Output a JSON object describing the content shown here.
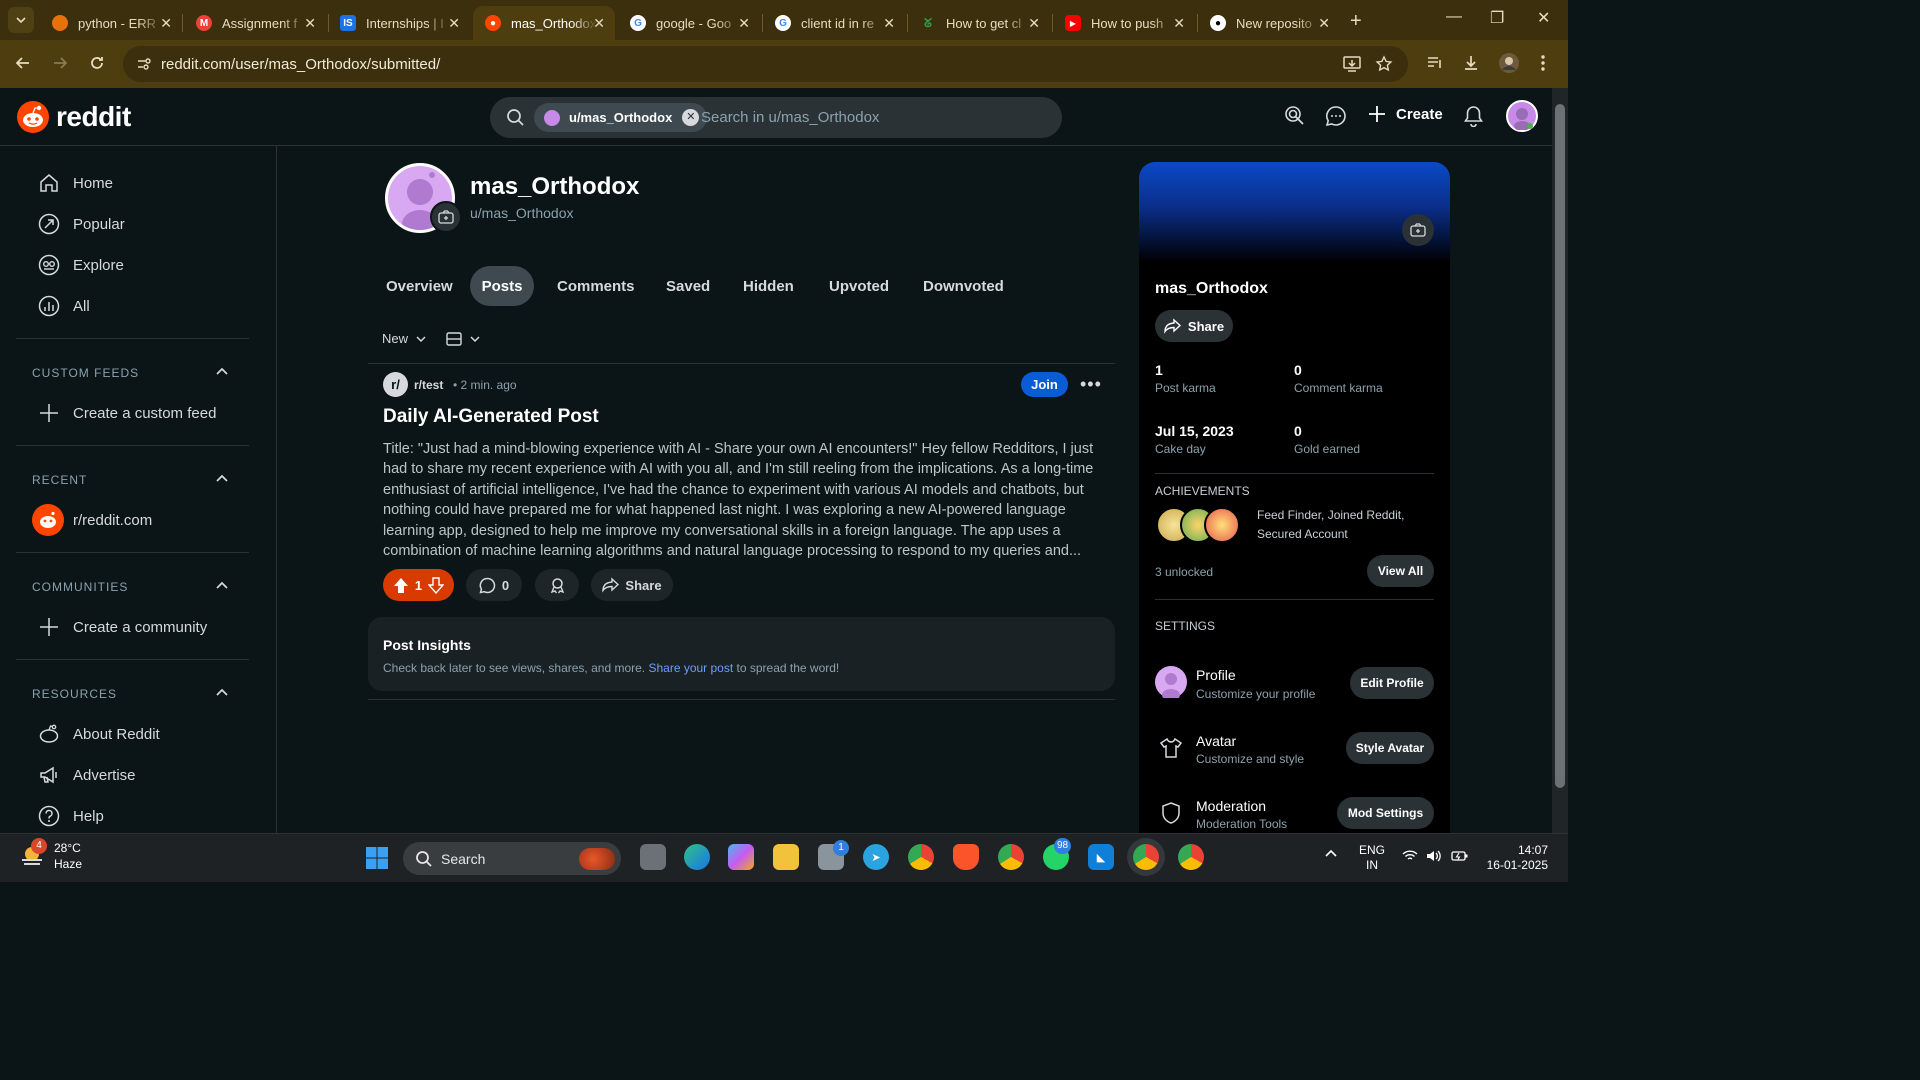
{
  "browser": {
    "tabs": [
      {
        "label": "python - ERR",
        "favicon_color": "#e8710a"
      },
      {
        "label": "Assignment f",
        "favicon_color": "#ea4335"
      },
      {
        "label": "Internships | I",
        "favicon_color": "#1a73e8"
      },
      {
        "label": "mas_Orthodox",
        "favicon_color": "#ff4500",
        "active": true
      },
      {
        "label": "google - Goo",
        "favicon_color": "#4285f4"
      },
      {
        "label": "client id in re",
        "favicon_color": "#4285f4"
      },
      {
        "label": "How to get cl",
        "favicon_color": "#2e7d32"
      },
      {
        "label": "How to push",
        "favicon_color": "#ff0000"
      },
      {
        "label": "New reposito",
        "favicon_color": "#ffffff"
      }
    ],
    "url": "reddit.com/user/mas_Orthodox/submitted/"
  },
  "header": {
    "logo_text": "reddit",
    "search_chip": "u/mas_Orthodox",
    "search_placeholder": "Search in u/mas_Orthodox",
    "create_label": "Create"
  },
  "sidebar": {
    "main_items": [
      {
        "label": "Home",
        "icon": "home-icon"
      },
      {
        "label": "Popular",
        "icon": "popular-icon"
      },
      {
        "label": "Explore",
        "icon": "explore-icon"
      },
      {
        "label": "All",
        "icon": "all-icon"
      }
    ],
    "custom_feeds": {
      "title": "CUSTOM FEEDS",
      "items": [
        {
          "label": "Create a custom feed"
        }
      ]
    },
    "recent": {
      "title": "RECENT",
      "items": [
        {
          "label": "r/reddit.com"
        }
      ]
    },
    "communities": {
      "title": "COMMUNITIES",
      "items": [
        {
          "label": "Create a community"
        }
      ]
    },
    "resources": {
      "title": "RESOURCES",
      "items": [
        {
          "label": "About Reddit",
          "icon": "reddit-alien-icon"
        },
        {
          "label": "Advertise",
          "icon": "megaphone-icon"
        },
        {
          "label": "Help",
          "icon": "help-icon"
        }
      ]
    }
  },
  "profile": {
    "display_name": "mas_Orthodox",
    "handle": "u/mas_Orthodox",
    "tabs": [
      {
        "label": "Overview"
      },
      {
        "label": "Posts",
        "active": true
      },
      {
        "label": "Comments"
      },
      {
        "label": "Saved"
      },
      {
        "label": "Hidden"
      },
      {
        "label": "Upvoted"
      },
      {
        "label": "Downvoted"
      }
    ],
    "sort_label": "New"
  },
  "post": {
    "subreddit": "r/test",
    "time": "• 2 min. ago",
    "join_label": "Join",
    "title": "Daily AI-Generated Post",
    "body": "Title: \"Just had a mind-blowing experience with AI - Share your own AI encounters!\" Hey fellow Redditors, I just had to share my recent experience with AI with you all, and I'm still reeling from the implications. As a long-time enthusiast of artificial intelligence, I've had the chance to experiment with various AI models and chatbots, but nothing could have prepared me for what happened last night. I was exploring a new AI-powered language learning app, designed to help me improve my conversational skills in a foreign language. The app uses a combination of machine learning algorithms and natural language processing to respond to my queries and...",
    "votes": "1",
    "comments": "0",
    "share_label": "Share",
    "accent": "#d93a00"
  },
  "insights": {
    "title": "Post Insights",
    "text": "Check back later to see views, shares, and more.",
    "link": "Share your post",
    "text_after": "to spread the word!"
  },
  "profile_card": {
    "name": "mas_Orthodox",
    "share_label": "Share",
    "stats": [
      {
        "value": "1",
        "label": "Post karma"
      },
      {
        "value": "0",
        "label": "Comment karma"
      },
      {
        "value": "Jul 15, 2023",
        "label": "Cake day"
      },
      {
        "value": "0",
        "label": "Gold earned"
      }
    ],
    "achievements_title": "ACHIEVEMENTS",
    "achievements_text": "Feed Finder, Joined Reddit, Secured Account",
    "unlocked_text": "3 unlocked",
    "view_all_label": "View All",
    "settings_title": "SETTINGS",
    "settings": [
      {
        "title": "Profile",
        "subtitle": "Customize your profile",
        "button": "Edit Profile"
      },
      {
        "title": "Avatar",
        "subtitle": "Customize and style",
        "button": "Style Avatar"
      },
      {
        "title": "Moderation",
        "subtitle": "Moderation Tools",
        "button": "Mod Settings"
      }
    ]
  },
  "taskbar": {
    "weather_badge": "4",
    "temperature": "28°C",
    "condition": "Haze",
    "search_label": "Search",
    "badges": {
      "app1": "1",
      "whatsapp": "98"
    },
    "lang": "ENG",
    "region": "IN",
    "time": "14:07",
    "date": "16-01-2025"
  }
}
